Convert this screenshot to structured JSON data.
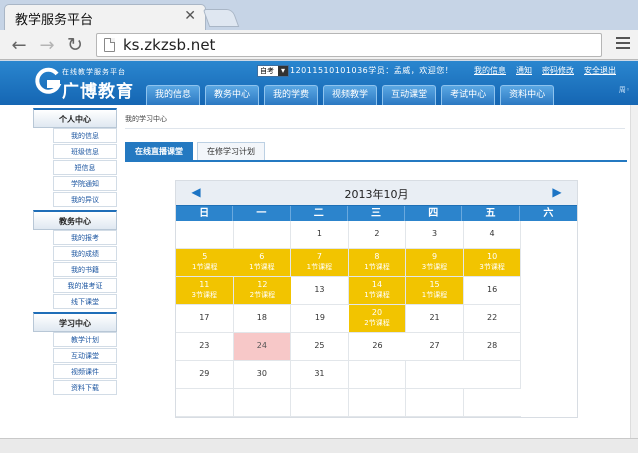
{
  "browser": {
    "tab_title": "教学服务平台",
    "url": "ks.zkzsb.net"
  },
  "header": {
    "logo_small": "在线教学服务平台",
    "logo_big": "广博教育",
    "dropdown_value": "自考",
    "welcome": "12011510101036学员：孟威，欢迎您！",
    "links": [
      "我的信息",
      "通知",
      "密码修改",
      "安全退出"
    ],
    "nav_tabs": [
      "我的信息",
      "教务中心",
      "我的学费",
      "视频教学",
      "互动课堂",
      "考试中心",
      "资料中心"
    ],
    "right_text": "周◦"
  },
  "sidebar": {
    "sections": [
      {
        "title": "个人中心",
        "items": [
          "我的信息",
          "班级信息",
          "短信息",
          "学院通知",
          "我的异议"
        ]
      },
      {
        "title": "教务中心",
        "items": [
          "我的报考",
          "我的成绩",
          "我的书籍",
          "我的准考证",
          "线下课堂"
        ]
      },
      {
        "title": "学习中心",
        "items": [
          "教学计划",
          "互动课堂",
          "视频课件",
          "资料下载"
        ]
      }
    ]
  },
  "main": {
    "breadcrumb": "我的学习中心",
    "tabs": [
      "在线直播课堂",
      "在修学习计划"
    ],
    "active_tab": 0
  },
  "calendar": {
    "title": "2013年10月",
    "weekdays": [
      "日",
      "一",
      "二",
      "三",
      "四",
      "五",
      "六"
    ],
    "cells": [
      {
        "day": "",
        "note": ""
      },
      {
        "day": "",
        "note": ""
      },
      {
        "day": "1",
        "note": ""
      },
      {
        "day": "2",
        "note": ""
      },
      {
        "day": "3",
        "note": ""
      },
      {
        "day": "4",
        "note": ""
      },
      {
        "day": "5",
        "note": "1节课程"
      },
      {
        "day": "6",
        "note": "1节课程"
      },
      {
        "day": "7",
        "note": "1节课程"
      },
      {
        "day": "8",
        "note": "1节课程"
      },
      {
        "day": "9",
        "note": "3节课程"
      },
      {
        "day": "10",
        "note": "3节课程"
      },
      {
        "day": "11",
        "note": "3节课程"
      },
      {
        "day": "12",
        "note": "2节课程"
      },
      {
        "day": "13",
        "note": ""
      },
      {
        "day": "14",
        "note": "1节课程"
      },
      {
        "day": "15",
        "note": "1节课程"
      },
      {
        "day": "16",
        "note": ""
      },
      {
        "day": "17",
        "note": ""
      },
      {
        "day": "18",
        "note": ""
      },
      {
        "day": "19",
        "note": ""
      },
      {
        "day": "20",
        "note": "2节课程"
      },
      {
        "day": "21",
        "note": ""
      },
      {
        "day": "22",
        "note": ""
      },
      {
        "day": "23",
        "note": ""
      },
      {
        "day": "24",
        "note": "",
        "today": true
      },
      {
        "day": "25",
        "note": ""
      },
      {
        "day": "26",
        "note": ""
      },
      {
        "day": "27",
        "note": ""
      },
      {
        "day": "28",
        "note": ""
      },
      {
        "day": "29",
        "note": ""
      },
      {
        "day": "30",
        "note": ""
      },
      {
        "day": "31",
        "note": ""
      },
      {
        "day": "",
        "note": ""
      },
      {
        "day": "",
        "note": ""
      },
      {
        "day": "",
        "note": ""
      },
      {
        "day": "",
        "note": ""
      },
      {
        "day": "",
        "note": ""
      },
      {
        "day": "",
        "note": ""
      },
      {
        "day": "",
        "note": ""
      },
      {
        "day": "",
        "note": ""
      },
      {
        "day": "",
        "note": ""
      }
    ]
  },
  "colors": {
    "header_blue": "#1f72bf",
    "class_day": "#f2c400",
    "today": "#f7c8c8"
  }
}
